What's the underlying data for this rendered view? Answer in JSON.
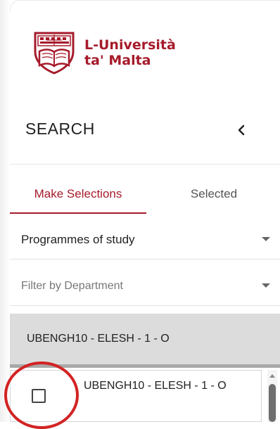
{
  "logo": {
    "line1": "L-Università",
    "line2": "ta' Malta",
    "brand_color": "#a61b2b",
    "icon": "university-crest-icon"
  },
  "search_header": {
    "title": "SEARCH",
    "collapse_icon": "chevron-left-icon"
  },
  "tabs": [
    {
      "label": "Make Selections",
      "active": true
    },
    {
      "label": "Selected",
      "active": false
    }
  ],
  "filters": {
    "programmes": {
      "value": "Programmes of study",
      "icon": "caret-down-icon"
    },
    "department": {
      "placeholder": "Filter by Department",
      "icon": "caret-down-icon"
    }
  },
  "search": {
    "value": "UBENGH10 - ELESH - 1 - O"
  },
  "results": [
    {
      "label": "UBENGH10 - ELESH - 1 - O",
      "checked": false
    }
  ],
  "colors": {
    "accent": "#a61b2b",
    "annotation": "#d32323",
    "input_bg": "#dcdcdc"
  }
}
